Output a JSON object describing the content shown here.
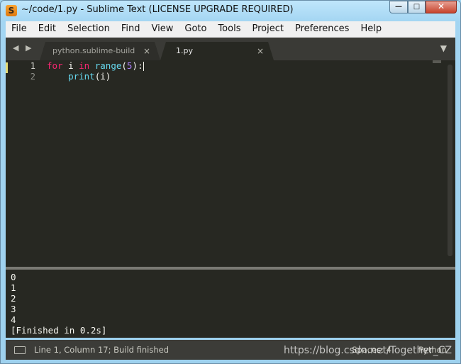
{
  "window": {
    "title": "~/code/1.py - Sublime Text (LICENSE UPGRADE REQUIRED)",
    "app_icon_letter": "S",
    "minimize_label": "—",
    "maximize_label": "□",
    "close_label": "✕"
  },
  "menubar": {
    "items": [
      "File",
      "Edit",
      "Selection",
      "Find",
      "View",
      "Goto",
      "Tools",
      "Project",
      "Preferences",
      "Help"
    ]
  },
  "tabs": {
    "nav_arrows": "◀ ▶",
    "items": [
      {
        "label": "python.sublime-build",
        "active": false,
        "close": "×"
      },
      {
        "label": "1.py",
        "active": true,
        "close": "×"
      }
    ],
    "menu_icon": "▼"
  },
  "editor": {
    "line_numbers": [
      "1",
      "2"
    ],
    "lines": [
      {
        "tokens": [
          [
            "for",
            "kw"
          ],
          [
            " i ",
            ""
          ],
          [
            "in",
            "kw"
          ],
          [
            " ",
            ""
          ],
          [
            "range",
            "fn"
          ],
          [
            "(",
            ""
          ],
          [
            "5",
            "num"
          ],
          [
            "):",
            ""
          ]
        ]
      },
      {
        "tokens": [
          [
            "    ",
            ""
          ],
          [
            "print",
            "fn"
          ],
          [
            "(i)",
            ""
          ]
        ]
      }
    ]
  },
  "output": {
    "lines": [
      "0",
      "1",
      "2",
      "3",
      "4",
      "[Finished in 0.2s]"
    ]
  },
  "statusbar": {
    "position_text": "Line 1, Column 17; Build finished",
    "indentation": "Spaces: 4",
    "syntax": "Python"
  },
  "watermark": "https://blog.csdn.net/Together_CZ",
  "colors": {
    "editor_bg": "#272822",
    "keyword": "#f92672",
    "function": "#66d9ef",
    "number": "#ae81ff",
    "text": "#f8f8f2"
  }
}
